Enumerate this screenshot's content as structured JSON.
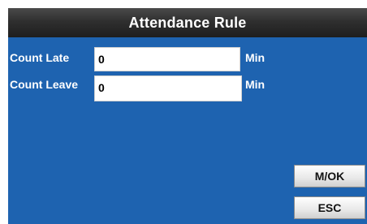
{
  "window": {
    "title": "Attendance Rule"
  },
  "form": {
    "rows": [
      {
        "label": "Count Late",
        "value": "0",
        "unit": "Min"
      },
      {
        "label": "Count Leave",
        "value": "0",
        "unit": "Min"
      }
    ]
  },
  "buttons": {
    "ok_label": "M/OK",
    "esc_label": "ESC"
  },
  "colors": {
    "title_bar": "#2f2f2f",
    "body_background": "#1e63b0",
    "text": "#ffffff",
    "field_background": "#ffffff",
    "button_background": "#e8e8e8"
  }
}
